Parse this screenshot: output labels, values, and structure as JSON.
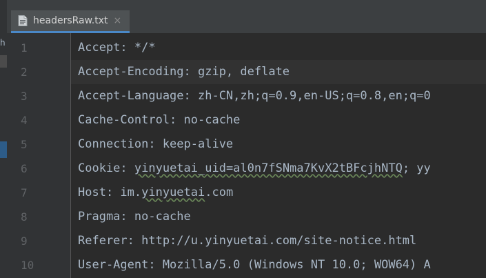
{
  "editor_tab": {
    "file_name": "headersRaw.txt",
    "close_glyph": "×",
    "icon": "text-file-icon"
  },
  "side_strip_fragment": "h",
  "lines": [
    {
      "number": "1",
      "text": "Accept: */*"
    },
    {
      "number": "2",
      "text": "Accept-Encoding: gzip, deflate"
    },
    {
      "number": "3",
      "text": "Accept-Language: zh-CN,zh;q=0.9,en-US;q=0.8,en;q=0"
    },
    {
      "number": "4",
      "text": "Cache-Control: no-cache"
    },
    {
      "number": "5",
      "text": "Connection: keep-alive"
    },
    {
      "number": "6",
      "pre": "Cookie: ",
      "squiggle": "yinyuetai_uid=al0n7fSNma7KvX2tBFcjhNTQ",
      "post": "; yy"
    },
    {
      "number": "7",
      "pre": "Host: im.",
      "squiggle": "yinyuetai",
      "post": ".com"
    },
    {
      "number": "8",
      "text": "Pragma: no-cache"
    },
    {
      "number": "9",
      "text": "Referer: http://u.yinyuetai.com/site-notice.html"
    },
    {
      "number": "10",
      "text": "User-Agent: Mozilla/5.0 (Windows NT 10.0; WOW64) A"
    }
  ],
  "colors": {
    "editor_bg": "#2b2b2b",
    "gutter_bg": "#313335",
    "text": "#a9b7c6",
    "line_number": "#606366",
    "current_line": "#323232",
    "tab_underline": "#4a88c7"
  }
}
